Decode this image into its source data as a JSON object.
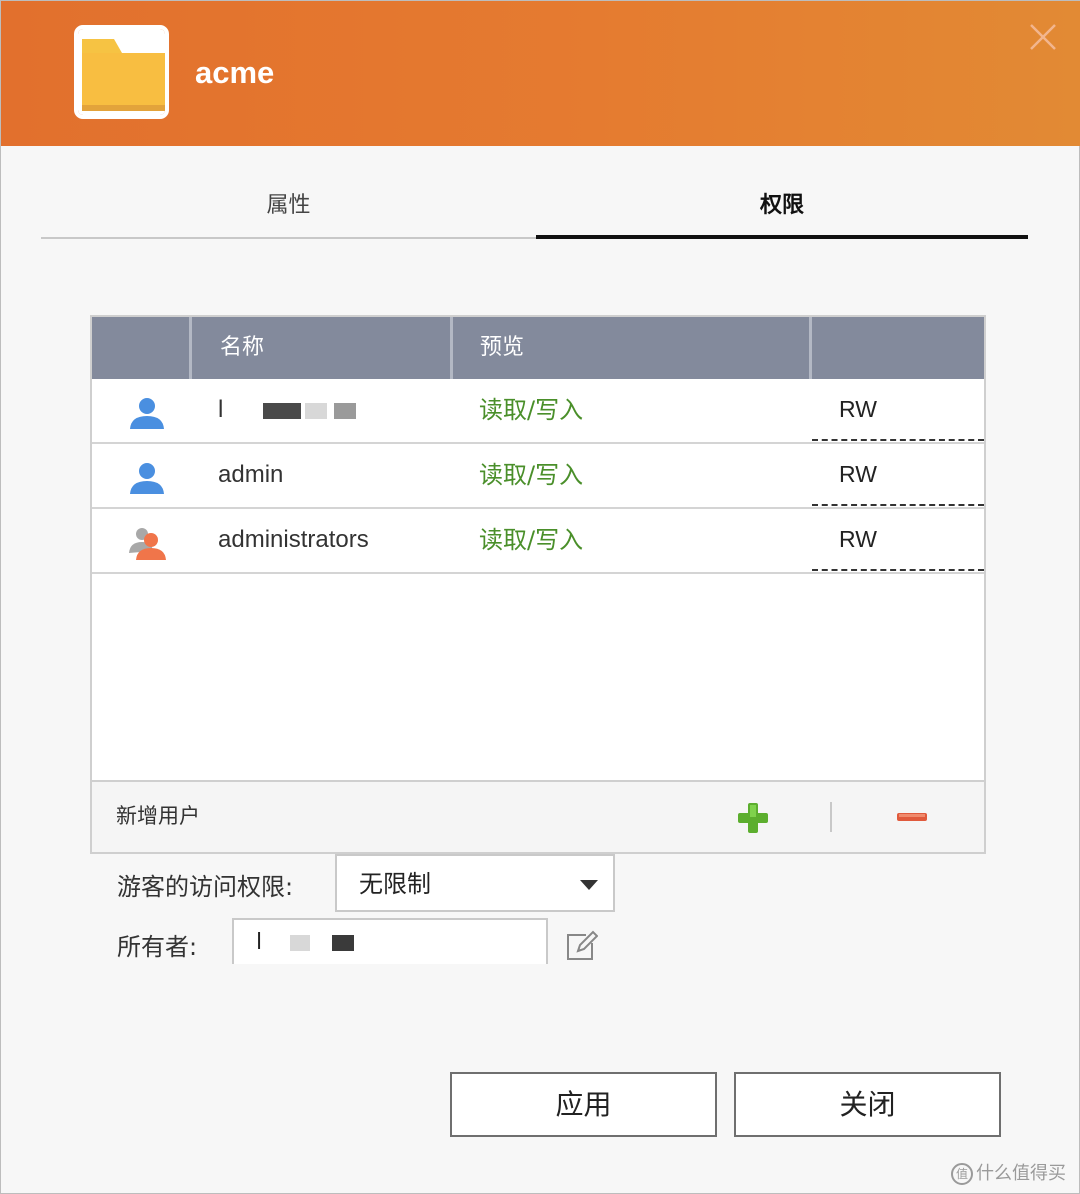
{
  "window": {
    "title": "acme",
    "folder_icon": "folder-icon",
    "close_icon": "close-icon",
    "accent_color": "#e2702d"
  },
  "tabs": [
    {
      "label": "属性",
      "active": false
    },
    {
      "label": "权限",
      "active": true
    }
  ],
  "permissions_table": {
    "columns": [
      "",
      "名称",
      "预览",
      ""
    ],
    "rows": [
      {
        "icon": "user-icon",
        "name": "l",
        "name_redacted": true,
        "permission": "读取/写入",
        "access": "RW"
      },
      {
        "icon": "user-icon",
        "name": "admin",
        "name_redacted": false,
        "permission": "读取/写入",
        "access": "RW"
      },
      {
        "icon": "group-icon",
        "name": "administrators",
        "name_redacted": false,
        "permission": "读取/写入",
        "access": "RW"
      }
    ],
    "add_user_label": "新增用户",
    "add_icon": "plus-icon",
    "remove_icon": "minus-icon",
    "permission_color": "#4a8f2a"
  },
  "guest_access": {
    "label": "游客的访问权限:",
    "value": "无限制"
  },
  "owner": {
    "label": "所有者:",
    "value": "l",
    "redacted": true
  },
  "buttons": {
    "apply": "应用",
    "close": "关闭"
  },
  "watermark": {
    "logo": "值",
    "text": "什么值得买"
  }
}
